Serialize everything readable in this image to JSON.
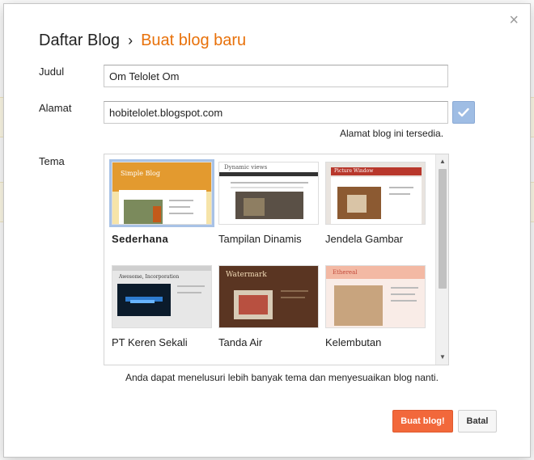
{
  "dialog": {
    "breadcrumb_root": "Daftar Blog",
    "breadcrumb_sep": "›",
    "title": "Buat blog baru",
    "close_label": "×"
  },
  "form": {
    "title_label": "Judul",
    "title_value": "Om Telolet Om",
    "address_label": "Alamat",
    "address_value": "hobitelolet.blogspot.com",
    "address_status": "Alamat blog ini tersedia.",
    "theme_label": "Tema"
  },
  "themes": [
    {
      "name": "Sederhana",
      "preview_title": "Simple Blog",
      "selected": true
    },
    {
      "name": "Tampilan Dinamis",
      "preview_title": "Dynamic views",
      "selected": false
    },
    {
      "name": "Jendela Gambar",
      "preview_title": "Picture Window",
      "selected": false
    },
    {
      "name": "PT Keren Sekali",
      "preview_title": "Awesome, Incorporation",
      "selected": false
    },
    {
      "name": "Tanda Air",
      "preview_title": "Watermark",
      "selected": false
    },
    {
      "name": "Kelembutan",
      "preview_title": "Ethereal",
      "selected": false
    }
  ],
  "footer": {
    "note": "Anda dapat menelusuri lebih banyak tema dan menyesuaikan blog nanti.",
    "create_button": "Buat blog!",
    "cancel_button": "Batal"
  },
  "colors": {
    "accent": "#e8710a",
    "primary_button": "#f2683b",
    "selected_outline": "#a8c2e6",
    "check_button": "#9fbde4"
  },
  "icons": {
    "close": "close-icon",
    "check": "check-icon",
    "scroll_up": "scroll-up-icon",
    "scroll_down": "scroll-down-icon"
  }
}
